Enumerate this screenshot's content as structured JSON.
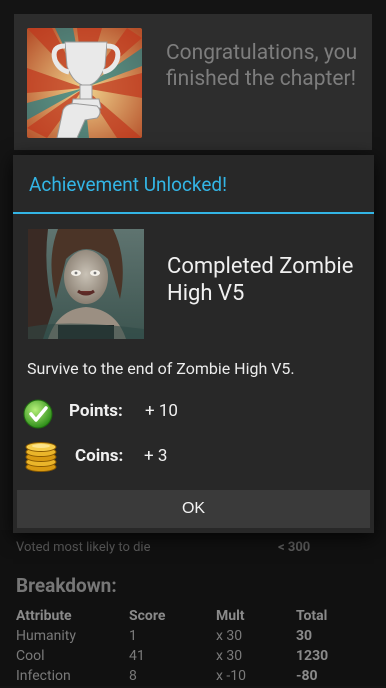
{
  "background": {
    "congrats_text": "Congratulations, you finished the chapter!",
    "voted_label": "Voted most likely to die",
    "voted_value": "< 300",
    "breakdown_title": "Breakdown:",
    "table": {
      "headers": [
        "Attribute",
        "Score",
        "Mult",
        "Total"
      ],
      "rows": [
        [
          "Humanity",
          "1",
          "x 30",
          "30"
        ],
        [
          "Cool",
          "41",
          "x 30",
          "1230"
        ],
        [
          "Infection",
          "8",
          "x -10",
          "-80"
        ]
      ]
    }
  },
  "dialog": {
    "title": "Achievement Unlocked!",
    "achievement_name": "Completed Zombie High V5",
    "description": "Survive to the end of Zombie High V5.",
    "points_label": "Points:",
    "points_value": "+ 10",
    "coins_label": "Coins:",
    "coins_value": "+ 3",
    "ok_label": "OK"
  },
  "icons": {
    "trophy": "trophy-icon",
    "check": "check-icon",
    "coins": "coins-icon"
  },
  "colors": {
    "accent": "#33b5e5",
    "dialog_bg": "#282828",
    "button_bg": "#3a3a3a"
  }
}
